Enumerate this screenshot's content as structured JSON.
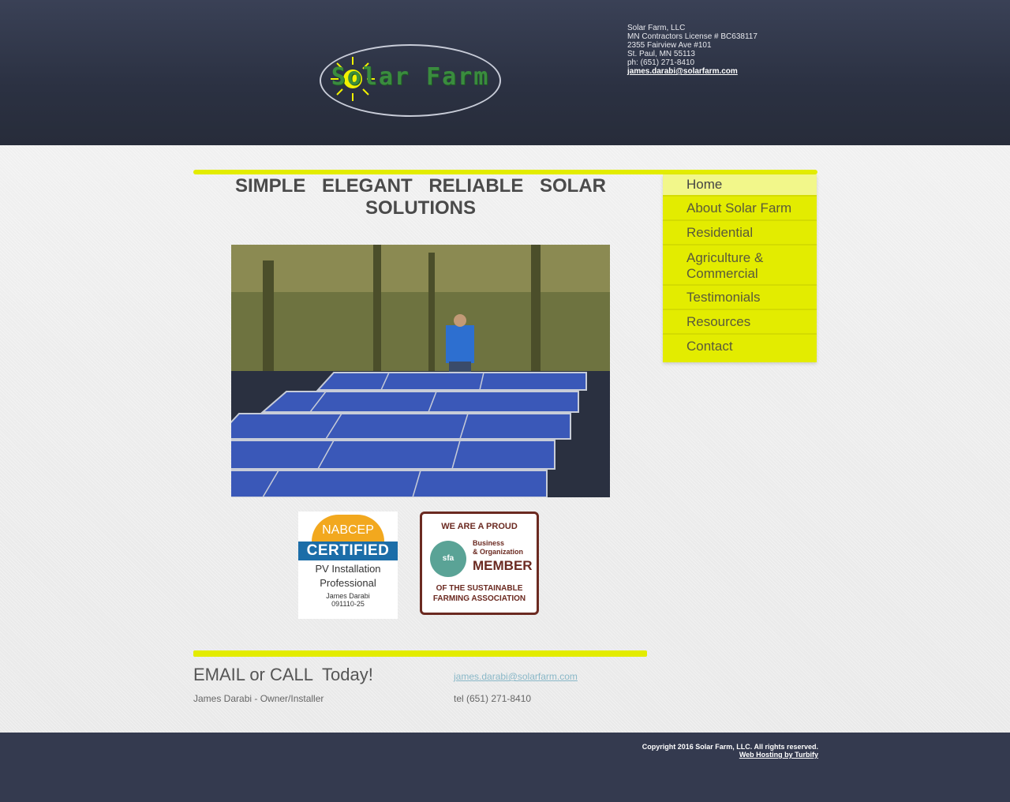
{
  "header": {
    "logo_text": "Solar Farm",
    "company": "Solar Farm, LLC",
    "license": "MN Contractors License # BC638117",
    "address": "2355 Fairview Ave #101",
    "city": "St. Paul, MN 55113",
    "phone": "ph: (651) 271-8410",
    "email": "james.darabi@solarfarm.com"
  },
  "main": {
    "tagline": "SIMPLE ELEGANT RELIABLE SOLAR SOLUTIONS",
    "nabcep": {
      "top": "NABCEP",
      "certified": "CERTIFIED",
      "line1": "PV Installation",
      "line2": "Professional",
      "name": "James Darabi",
      "number": "091110-25"
    },
    "sfa": {
      "line1": "WE ARE A PROUD",
      "logo": "sfa",
      "bo1": "Business",
      "bo2": "& Organization",
      "member": "MEMBER",
      "line3": "OF THE SUSTAINABLE",
      "line4": "FARMING ASSOCIATION"
    }
  },
  "nav": {
    "items": [
      {
        "label": "Home"
      },
      {
        "label": "About Solar Farm"
      },
      {
        "label": "Residential"
      },
      {
        "label": "Agriculture & Commercial"
      },
      {
        "label": "Testimonials"
      },
      {
        "label": "Resources"
      },
      {
        "label": "Contact"
      }
    ]
  },
  "contact": {
    "cta": "EMAIL or CALL  Today!",
    "email": "james.darabi@solarfarm.com",
    "owner": "James Darabi - Owner/Installer",
    "tel": "tel (651) 271-8410"
  },
  "footer": {
    "copyright": "Copyright 2016 Solar Farm, LLC. All rights reserved.",
    "hosting": "Web Hosting by Turbify"
  },
  "colors": {
    "accent": "#e3ec00",
    "header": "#2b3142"
  }
}
